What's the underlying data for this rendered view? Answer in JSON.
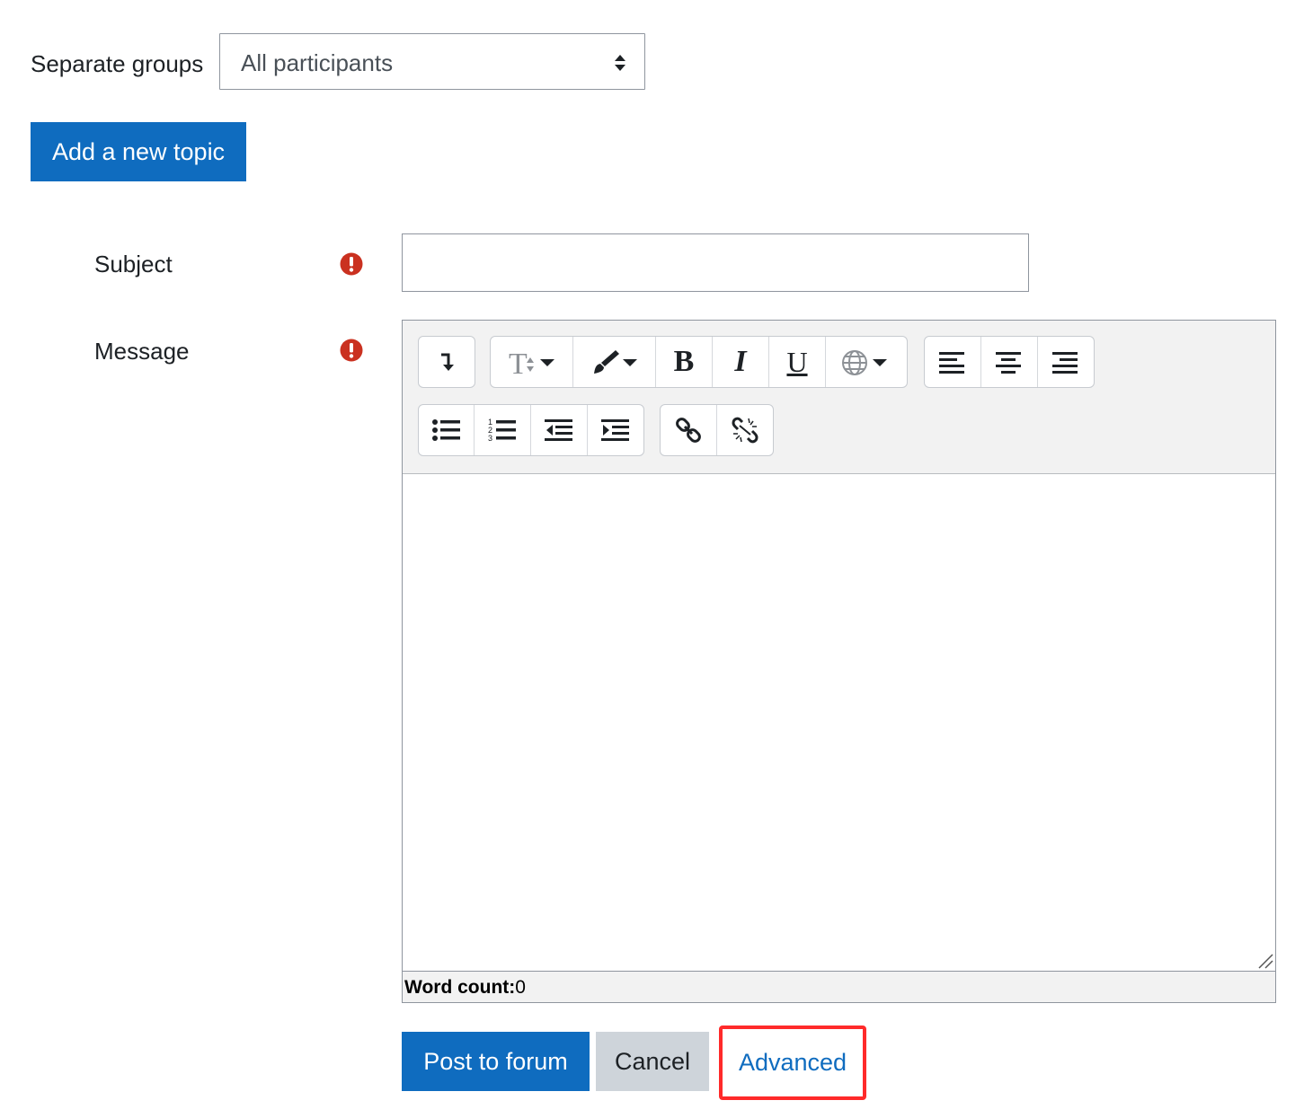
{
  "groups": {
    "label": "Separate groups",
    "selected": "All participants"
  },
  "actions": {
    "add_topic_label": "Add a new topic"
  },
  "form": {
    "subject_label": "Subject",
    "message_label": "Message",
    "subject_value": "",
    "required_icon": "exclamation-circle-icon"
  },
  "editor": {
    "toolbar": [
      [
        "collapse-toolbar"
      ],
      [
        "paragraph-styles",
        "text-color",
        "bold",
        "italic",
        "underline",
        "language"
      ],
      [
        "align-left",
        "align-center",
        "align-right"
      ],
      [
        "unordered-list",
        "ordered-list",
        "outdent",
        "indent"
      ],
      [
        "link",
        "unlink"
      ]
    ],
    "bold_glyph": "B",
    "italic_glyph": "I",
    "underline_glyph": "U",
    "word_count_label": "Word count:",
    "word_count_value": "0"
  },
  "footer": {
    "post_label": "Post to forum",
    "cancel_label": "Cancel",
    "advanced_label": "Advanced"
  },
  "colors": {
    "primary": "#0f6cbf",
    "required": "#ca3120",
    "highlight": "#ff2a2a",
    "secondary": "#ced4da"
  }
}
